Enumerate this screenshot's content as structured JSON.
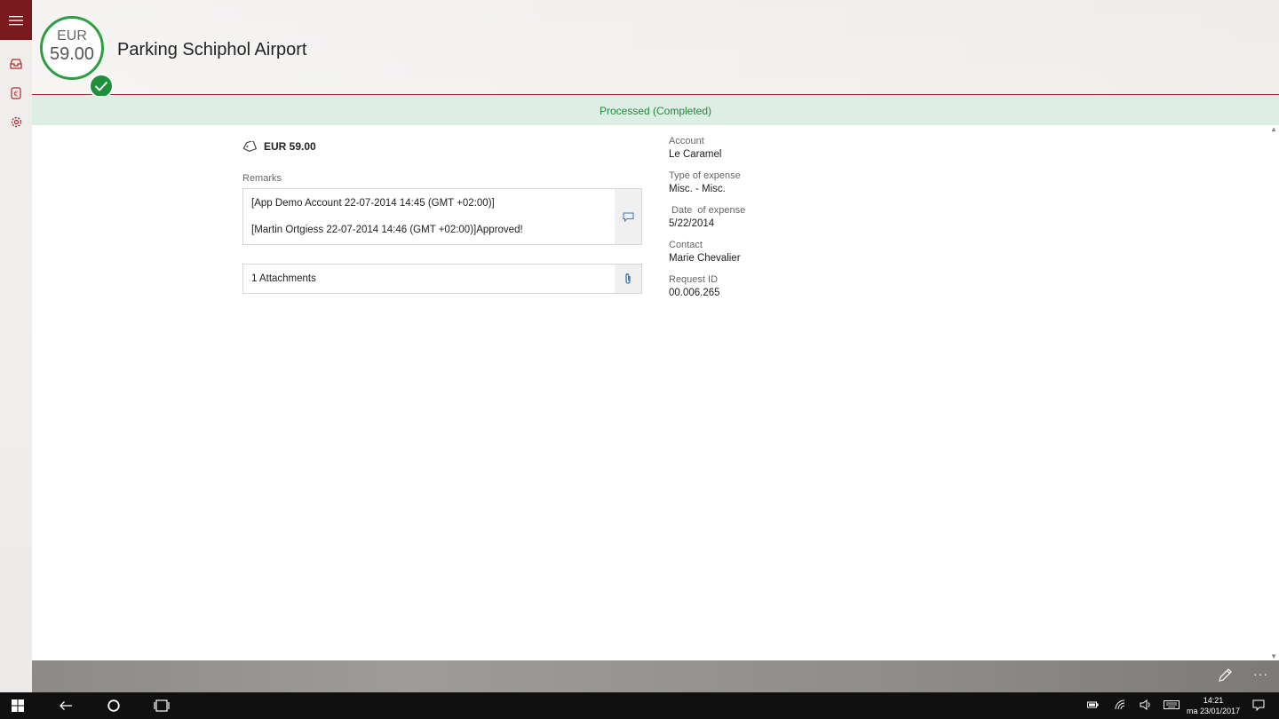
{
  "header": {
    "badge_currency": "EUR",
    "badge_amount": "59.00",
    "title": "Parking Schiphol Airport"
  },
  "status": "Processed (Completed)",
  "main": {
    "amount": "EUR 59.00",
    "remarks_label": "Remarks",
    "remarks": [
      "[App Demo Account 22-07-2014 14:45 (GMT +02:00)]",
      "[Martin Ortgiess 22-07-2014 14:46 (GMT +02:00)]Approved!"
    ],
    "attachments": "1 Attachments"
  },
  "details": [
    {
      "label": "Account",
      "value": "Le Caramel"
    },
    {
      "label": "Type of expense",
      "value": "Misc. - Misc."
    },
    {
      "label": " Date  of expense",
      "value": "5/22/2014"
    },
    {
      "label": "Contact",
      "value": "Marie Chevalier"
    },
    {
      "label": "Request ID",
      "value": "00.006.265"
    }
  ],
  "appbar": {
    "more": "···"
  },
  "taskbar": {
    "time": "14:21",
    "date": "ma 23/01/2017"
  },
  "colors": {
    "accent": "#7a1a1f",
    "status_bg": "#dfeee4",
    "status_text": "#1d8a3c",
    "check": "#1f8f3c"
  },
  "icons": [
    "hamburger-icon",
    "inbox-icon",
    "expense-icon",
    "settings-icon",
    "tag-icon",
    "comment-icon",
    "paperclip-icon",
    "edit-icon",
    "windows-icon",
    "back-icon",
    "cortana-icon",
    "task-view-icon",
    "battery-icon",
    "wifi-icon",
    "volume-icon",
    "keyboard-icon",
    "notifications-icon"
  ]
}
